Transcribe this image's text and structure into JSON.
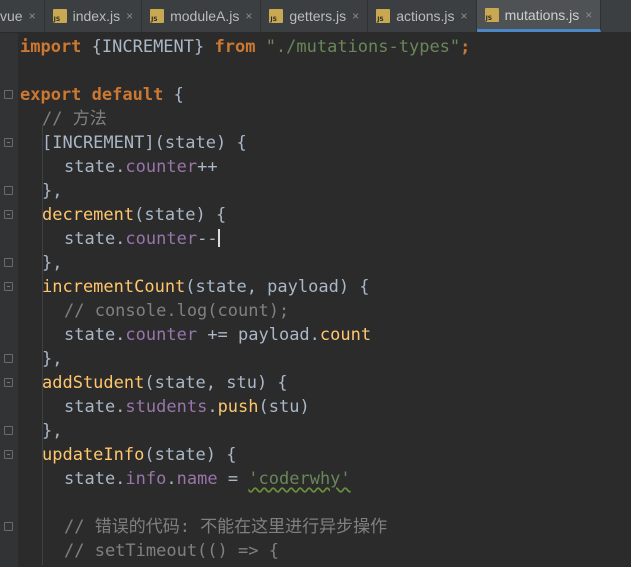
{
  "tabs": [
    {
      "label": "vue",
      "icon": "none",
      "active": false
    },
    {
      "label": "index.js",
      "icon": "js-file-icon",
      "active": false
    },
    {
      "label": "moduleA.js",
      "icon": "js-file-icon",
      "active": false
    },
    {
      "label": "getters.js",
      "icon": "js-file-icon",
      "active": false
    },
    {
      "label": "actions.js",
      "icon": "js-file-icon",
      "active": false
    },
    {
      "label": "mutations.js",
      "icon": "js-file-icon",
      "active": true
    }
  ],
  "close_glyph": "×",
  "code": {
    "l1": {
      "import": "import",
      "brace": " {INCREMENT} ",
      "from": "from",
      "space": " ",
      "path": "\"./mutations-types\"",
      "semi": ";"
    },
    "l3": {
      "export": "export",
      "sp": " ",
      "default": "default",
      "rest": " {"
    },
    "l4": {
      "comment": "// 方法"
    },
    "l5": {
      "text": "[INCREMENT](state) {"
    },
    "l6": {
      "a": "state.",
      "b": "counter",
      "c": "++"
    },
    "l7": {
      "text": "},"
    },
    "l8": {
      "fn": "decrement",
      "rest": "(state) {"
    },
    "l9": {
      "a": "state.",
      "b": "counter",
      "c": "--"
    },
    "l10": {
      "text": "},"
    },
    "l11": {
      "fn": "incrementCount",
      "rest": "(state, payload) {"
    },
    "l12": {
      "comment": "// console.log(count);"
    },
    "l13": {
      "a": "state.",
      "b": "counter",
      "c": " += payload.",
      "d": "count"
    },
    "l14": {
      "text": "},"
    },
    "l15": {
      "fn": "addStudent",
      "rest": "(state, stu) {"
    },
    "l16": {
      "a": "state.",
      "b": "students",
      "c": ".",
      "d": "push",
      "e": "(stu)"
    },
    "l17": {
      "text": "},"
    },
    "l18": {
      "fn": "updateInfo",
      "rest": "(state) {"
    },
    "l19": {
      "a": "state.",
      "b": "info",
      "c": ".",
      "d": "name",
      "e": " = ",
      "f": "'coderwhy'"
    },
    "l21": {
      "comment": "// 错误的代码: 不能在这里进行异步操作"
    },
    "l22": {
      "comment": "// setTimeout(() => {"
    }
  },
  "colors": {
    "background": "#2b2b2b",
    "keyword": "#cc7832",
    "string": "#6a8759",
    "comment": "#808080",
    "property": "#9876aa",
    "function": "#ffc66d",
    "text": "#a9b7c6"
  }
}
